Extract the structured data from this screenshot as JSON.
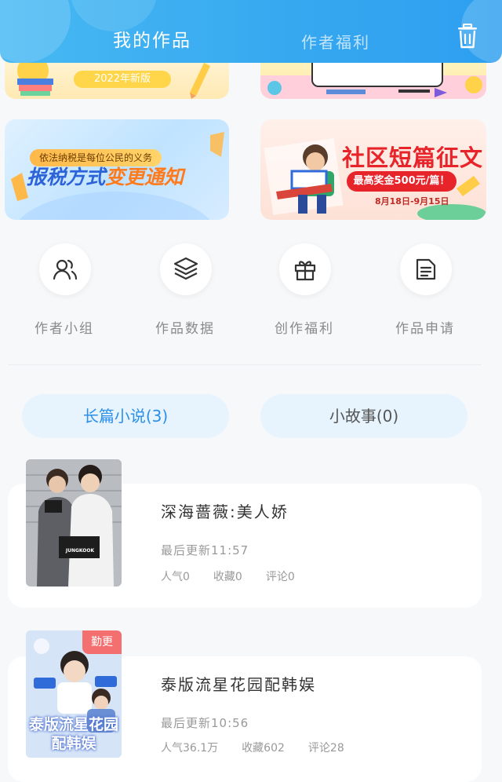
{
  "header": {
    "tabs": [
      {
        "label": "我的作品",
        "active": true
      },
      {
        "label": "作者福利",
        "active": false
      }
    ],
    "trash_icon": "trash-icon",
    "accent": "#3aa6f0"
  },
  "banners": {
    "b1_tag": "2022年新版",
    "b3_subtitle": "依法纳税是每位公民的义务",
    "b3_title_part1": "报税方式",
    "b3_title_part2": "变更通知",
    "b4_title": "社区短篇征文",
    "b4_prize": "最高奖金500元/篇！",
    "b4_date": "8月18日-9月15日"
  },
  "quick_actions": [
    {
      "label": "作者小组",
      "icon": "author-group-icon"
    },
    {
      "label": "作品数据",
      "icon": "layers-icon"
    },
    {
      "label": "创作福利",
      "icon": "gift-icon"
    },
    {
      "label": "作品申请",
      "icon": "document-icon"
    }
  ],
  "segments": [
    {
      "label": "长篇小说(3)",
      "active": true
    },
    {
      "label": "小故事(0)",
      "active": false
    }
  ],
  "works": [
    {
      "title": "深海蔷薇:美人娇",
      "updated": "最后更新11:57",
      "popularity": "人气0",
      "favorites": "收藏0",
      "comments": "评论0",
      "badge": "",
      "cover_text": "JUNGKOOK"
    },
    {
      "title": "泰版流星花园配韩娱",
      "updated": "最后更新10:56",
      "popularity": "人气36.1万",
      "favorites": "收藏602",
      "comments": "评论28",
      "badge": "勤更",
      "cover_text": "泰版流星花园配韩娱"
    }
  ]
}
